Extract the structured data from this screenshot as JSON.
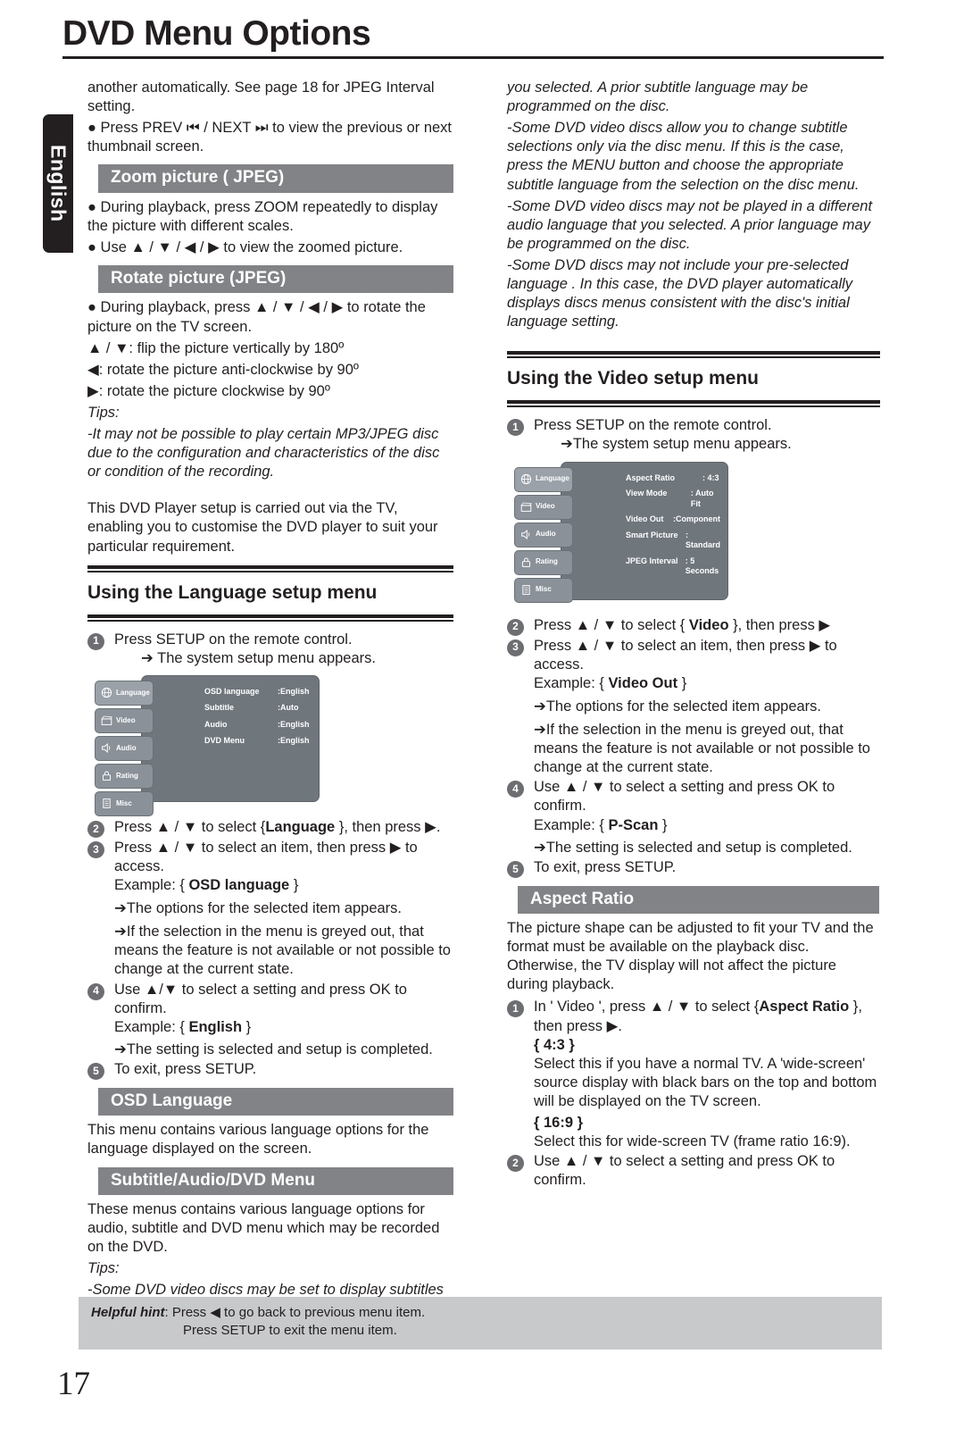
{
  "page": {
    "title": "DVD Menu Options",
    "side_tab": "English",
    "number": "17"
  },
  "left_column": {
    "intro_para": "another automatically. See page 18 for JPEG Interval setting.",
    "bullet_prev_next": "● Press PREV ⏮ / NEXT ⏭ to view the previous or next thumbnail screen.",
    "zoom_section": {
      "heading": "Zoom picture ( JPEG)",
      "bullets": [
        "● During playback, press ZOOM repeatedly to display the picture with different scales.",
        "● Use ▲ / ▼ / ◀ / ▶ to view the zoomed picture."
      ]
    },
    "rotate_section": {
      "heading": "Rotate picture (JPEG)",
      "bullet": "● During playback, press ▲ / ▼ / ◀ / ▶ to rotate the picture on the TV screen.",
      "keys": [
        "▲ / ▼: flip the picture vertically by 180º",
        "◀: rotate the picture anti-clockwise by 90º",
        "▶: rotate the picture clockwise by 90º"
      ],
      "tips_label": "Tips:",
      "tips_text": "-It may not be possible to play certain MP3/JPEG disc due to the configuration and characteristics of the disc or condition of the recording."
    },
    "setup_intro": "This DVD Player setup is carried out via the TV, enabling you to customise the DVD player to suit your particular requirement.",
    "language_menu": {
      "heading": "Using the Language  setup menu",
      "steps": [
        {
          "num": "1",
          "text": "Press SETUP on the remote control."
        },
        {
          "num": "2",
          "text": "Press ▲ / ▼ to select {Language }, then press ▶."
        },
        {
          "num": "3",
          "text": "Press ▲ / ▼ to select an item, then press ▶ to access."
        },
        {
          "num": "4",
          "text": "Use ▲/▼ to select a setting and press OK to confirm."
        },
        {
          "num": "5",
          "text": "To exit, press SETUP."
        }
      ],
      "step1_result": "➔ The system setup menu appears.",
      "step3_example_label": "Example: {",
      "step3_example_value": "OSD language",
      "step3_example_close": "}",
      "step3_result_a": "➔The options for the selected item appears.",
      "step3_result_b": "➔If the selection in the menu is greyed out, that means the feature is not available or not possible to change at the current state.",
      "step4_example_label": "Example: {",
      "step4_example_value": "English",
      "step4_example_close": "}",
      "step4_result": "➔The setting is selected and setup is completed.",
      "select_bold": "Language",
      "osd_screen": {
        "tabs": [
          {
            "label": "Language",
            "icon": "language-globe-icon",
            "active": true
          },
          {
            "label": "Video",
            "icon": "video-clapper-icon",
            "active": false
          },
          {
            "label": "Audio",
            "icon": "audio-speaker-icon",
            "active": false
          },
          {
            "label": "Rating",
            "icon": "rating-lock-icon",
            "active": false
          },
          {
            "label": "Misc",
            "icon": "misc-document-icon",
            "active": false
          }
        ],
        "rows": [
          {
            "key": "OSD language",
            "value": ":English"
          },
          {
            "key": "Subtitle",
            "value": ":Auto"
          },
          {
            "key": "Audio",
            "value": ":English"
          },
          {
            "key": "DVD Menu",
            "value": ":English"
          }
        ]
      }
    },
    "osd_language_section": {
      "heading": "OSD Language",
      "text": "This menu contains various language options for the language displayed on the screen."
    },
    "subtitle_audio_section": {
      "heading": "Subtitle/Audio/DVD Menu",
      "text": "These menus contains various language options for audio, subtitle and DVD menu which may be recorded on the DVD.",
      "tips_label": "Tips:",
      "tips_text": "-Some DVD video discs may be set to display subtitles in a different language other than"
    }
  },
  "right_column": {
    "tips_continued": [
      "you selected. A prior subtitle language may be programmed on the disc.",
      "-Some DVD video discs allow you to change subtitle selections only via the disc menu. If this is the case, press the MENU button and choose the appropriate subtitle language  from the selection on the disc menu.",
      "-Some DVD video discs may not be played in a different audio language that you selected. A prior language may be programmed on the disc.",
      "-Some DVD discs may not include your pre-selected language . In this case, the DVD player automatically displays discs menus consistent with the disc's initial language setting."
    ],
    "video_menu": {
      "heading": "Using the Video setup menu",
      "steps": [
        {
          "num": "1",
          "text": "Press SETUP on the remote control."
        },
        {
          "num": "2",
          "text": "Press ▲ / ▼ to select { Video }, then press ▶"
        },
        {
          "num": "3",
          "text": "Press ▲ / ▼ to select an item, then press ▶ to access."
        },
        {
          "num": "4",
          "text": "Use ▲ / ▼ to select a setting and press OK to confirm."
        },
        {
          "num": "5",
          "text": "To exit, press SETUP."
        }
      ],
      "step1_result": "➔The system setup menu appears.",
      "select_bold": "Video",
      "step3_example_label": "Example: {",
      "step3_example_value": "Video Out",
      "step3_example_close": "}",
      "step3_result_a": "➔The options for the selected item appears.",
      "step3_result_b": "➔If the selection in the menu is greyed out, that means the feature is not available or not possible to change at the current state.",
      "step4_example_label": "Example: {",
      "step4_example_value": "P-Scan",
      "step4_example_close": "}",
      "step4_result": "➔The setting is selected and setup is completed.",
      "osd_screen": {
        "tabs": [
          {
            "label": "Language",
            "icon": "language-globe-icon",
            "active": true
          },
          {
            "label": "Video",
            "icon": "video-clapper-icon",
            "active": false
          },
          {
            "label": "Audio",
            "icon": "audio-speaker-icon",
            "active": false
          },
          {
            "label": "Rating",
            "icon": "rating-lock-icon",
            "active": false
          },
          {
            "label": "Misc",
            "icon": "misc-document-icon",
            "active": false
          }
        ],
        "rows": [
          {
            "key": "Aspect Ratio",
            "value": ": 4:3"
          },
          {
            "key": "View Mode",
            "value": ": Auto Fit"
          },
          {
            "key": "Video Out",
            "value": ":Component"
          },
          {
            "key": "Smart Picture",
            "value": ": Standard"
          },
          {
            "key": "JPEG Interval",
            "value": ": 5 Seconds"
          }
        ]
      }
    },
    "aspect_ratio_section": {
      "heading": "Aspect Ratio",
      "text": "The picture shape can be adjusted to fit your TV and the format must be available on the playback disc. Otherwise, the TV display will not affect the picture during playback.",
      "steps": [
        {
          "num": "1",
          "text": "In ' Video ', press ▲ / ▼ to select {Aspect Ratio }, then press ▶."
        },
        {
          "num": "2",
          "text": "Use ▲ / ▼ to select a setting and press OK to confirm."
        }
      ],
      "step1_bold": "Aspect Ratio",
      "option_43_label": "{ 4:3 }",
      "option_43_text": "Select this if you have a normal TV. A  'wide-screen' source display with black bars on the top and bottom will be displayed on the TV screen.",
      "option_169_label": "{ 16:9 }",
      "option_169_text": "Select this for wide-screen TV (frame ratio 16:9)."
    }
  },
  "footer": {
    "hint_label": "Helpful hint",
    "hint_line1": ": Press ◀ to go back to previous menu item.",
    "hint_line2": "Press SETUP to exit the menu item."
  },
  "colors": {
    "bar_gray": "#818386",
    "hint_gray": "#c7c9cb",
    "ink": "#231f20",
    "osd_panel": "#6f767c",
    "osd_tab": "#8a9198"
  }
}
